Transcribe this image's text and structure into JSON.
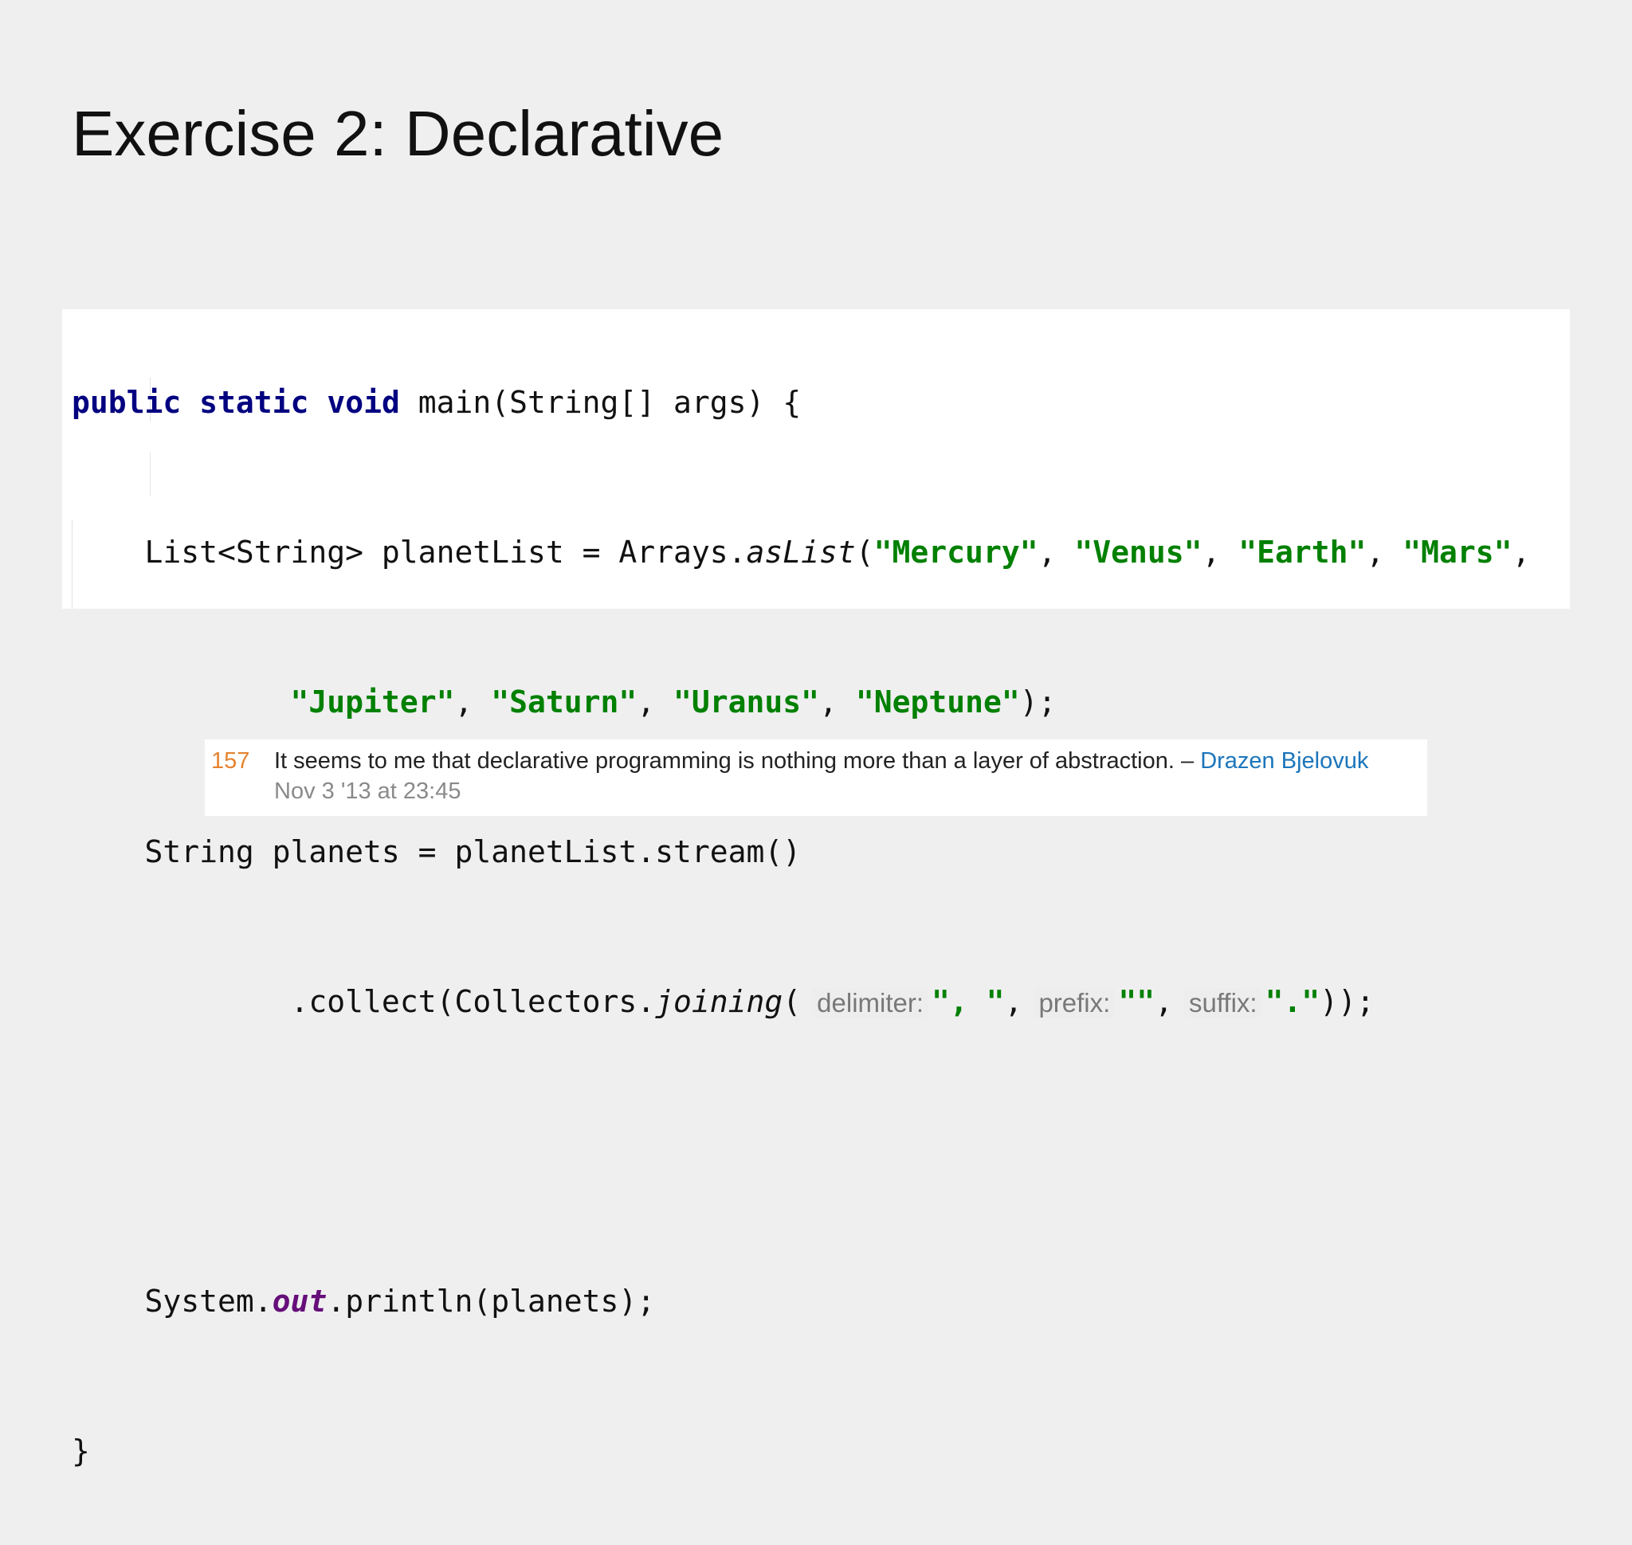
{
  "slide": {
    "title": "Exercise 2: Declarative"
  },
  "code": {
    "line1": {
      "kw_public": "public",
      "kw_static": "static",
      "kw_void": "void",
      "rest": "main(String[] args) {"
    },
    "line2": {
      "indent": "    ",
      "pre": "List<String> planetList = Arrays.",
      "call": "asList",
      "open": "(",
      "s1": "\"Mercury\"",
      "sep1": ", ",
      "s2": "\"Venus\"",
      "sep2": ", ",
      "s3": "\"Earth\"",
      "sep3": ", ",
      "s4": "\"Mars\"",
      "end": ","
    },
    "line3": {
      "indent": "            ",
      "s1": "\"Jupiter\"",
      "sep1": ", ",
      "s2": "\"Saturn\"",
      "sep2": ", ",
      "s3": "\"Uranus\"",
      "sep3": ", ",
      "s4": "\"Neptune\"",
      "end": ");"
    },
    "line4": {
      "indent": "    ",
      "text": "String planets = planetList.stream()"
    },
    "line5": {
      "indent": "            ",
      "pre": ".collect(Collectors.",
      "call": "joining",
      "open": "(",
      "hint1": "delimiter:",
      "arg1": "\", \"",
      "sep1": ",",
      "hint2": "prefix:",
      "arg2": "\"\"",
      "sep2": ",",
      "hint3": "suffix:",
      "arg3": "\".\"",
      "end": "));"
    },
    "line7": {
      "indent": "    ",
      "pre": "System.",
      "field": "out",
      "post": ".println(planets);"
    },
    "line8": {
      "text": "}"
    }
  },
  "comment": {
    "score": "157",
    "text": "It seems to me that declarative programming is nothing more than a layer of abstraction. – ",
    "author": "Drazen Bjelovuk",
    "date": "Nov 3 '13 at 23:45"
  },
  "colors": {
    "keyword": "#000080",
    "string": "#008000",
    "static_field": "#660e7a",
    "score": "#e5822e",
    "author_link": "#1b75bb"
  }
}
